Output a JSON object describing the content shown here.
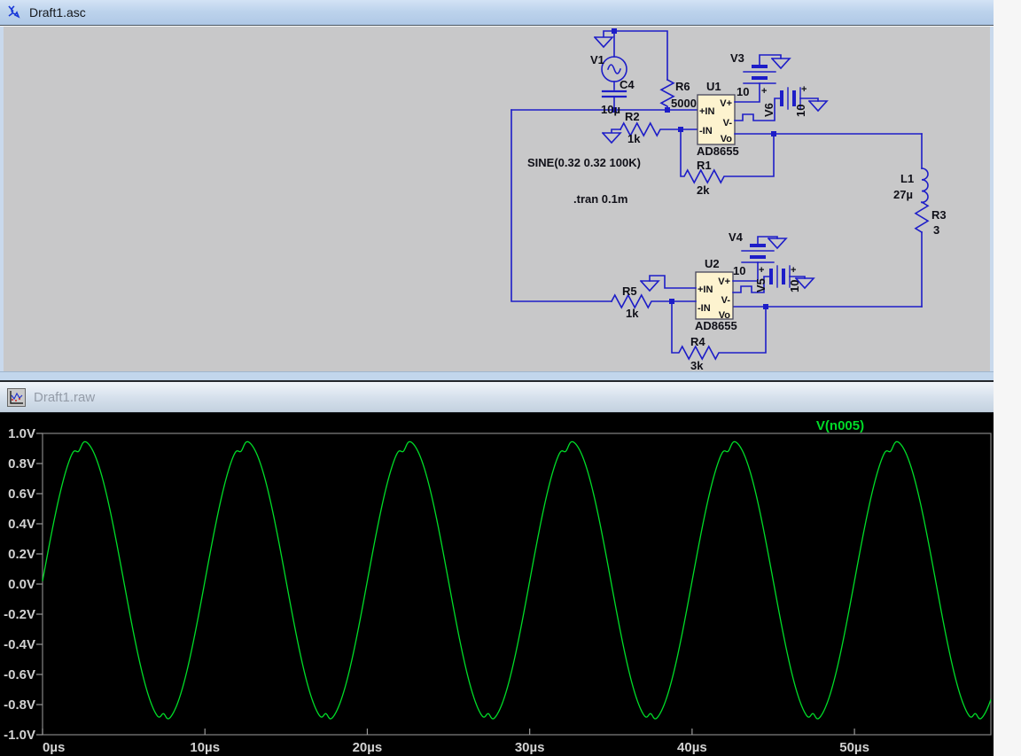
{
  "app": {
    "schematic_title": "Draft1.asc",
    "waveform_title": "Draft1.raw"
  },
  "colors": {
    "wire": "#1d1dc8",
    "schematic_bg": "#c8c8c9",
    "opamp_fill": "#fdf3cf",
    "plot_bg": "#000000",
    "plot_border": "#848484",
    "axis_text": "#d2d2d2",
    "trace_green": "#00dc28"
  },
  "schematic": {
    "directives": {
      "sine": "SINE(0.32 0.32 100K)",
      "tran": ".tran 0.1m"
    },
    "opamp_pins": {
      "vplus": "V+",
      "inplus": "+IN",
      "vminus": "V-",
      "inminus": "-IN",
      "out": "Vo"
    },
    "components": {
      "v1": {
        "name": "V1"
      },
      "c4": {
        "name": "C4",
        "value": "10µ"
      },
      "r2": {
        "name": "R2",
        "value": "1k"
      },
      "r6": {
        "name": "R6",
        "value": "5000"
      },
      "u1": {
        "name": "U1",
        "part": "AD8655"
      },
      "v3": {
        "name": "V3",
        "value": "10",
        "plus": "+"
      },
      "v6": {
        "name": "V6",
        "value": "10",
        "plus": "+"
      },
      "r1": {
        "name": "R1",
        "value": "2k"
      },
      "l1": {
        "name": "L1",
        "value": "27µ"
      },
      "r3": {
        "name": "R3",
        "value": "3"
      },
      "v4": {
        "name": "V4",
        "value": "10",
        "plus": "+"
      },
      "v5": {
        "name": "V5",
        "value": "10",
        "plus": "+"
      },
      "u2": {
        "name": "U2",
        "part": "AD8655"
      },
      "r5": {
        "name": "R5",
        "value": "1k"
      },
      "r4": {
        "name": "R4",
        "value": "3k"
      }
    }
  },
  "waveform_window": {
    "trace_label": "V(n005)"
  },
  "chart_data": {
    "type": "line",
    "title": "V(n005)",
    "x_ticks": [
      "0µs",
      "10µs",
      "20µs",
      "30µs",
      "40µs",
      "50µs"
    ],
    "x_tick_values_us": [
      0,
      10,
      20,
      30,
      40,
      50
    ],
    "y_ticks": [
      "1.0V",
      "0.8V",
      "0.6V",
      "0.4V",
      "0.2V",
      "0.0V",
      "-0.2V",
      "-0.4V",
      "-0.6V",
      "-0.8V",
      "-1.0V"
    ],
    "y_tick_values": [
      1.0,
      0.8,
      0.6,
      0.4,
      0.2,
      0.0,
      -0.2,
      -0.4,
      -0.6,
      -0.8,
      -1.0
    ],
    "xlim_us": [
      0,
      58.4
    ],
    "ylim": [
      -1.0,
      1.0
    ],
    "grid": false,
    "legend_position": "top",
    "series": [
      {
        "name": "V(n005)",
        "color": "#00dc28",
        "waveform": "sine",
        "amplitude_V": 0.93,
        "offset_V": 0.02,
        "frequency_kHz": 100,
        "period_us": 10,
        "phase_deg": 0,
        "distortion": {
          "peak_dip": {
            "center_deg": 80,
            "sigma_deg": 8,
            "depth_V": 0.055
          },
          "trough_bump": {
            "center_deg": 268,
            "sigma_deg": 7,
            "height_V": 0.05
          }
        }
      }
    ]
  }
}
